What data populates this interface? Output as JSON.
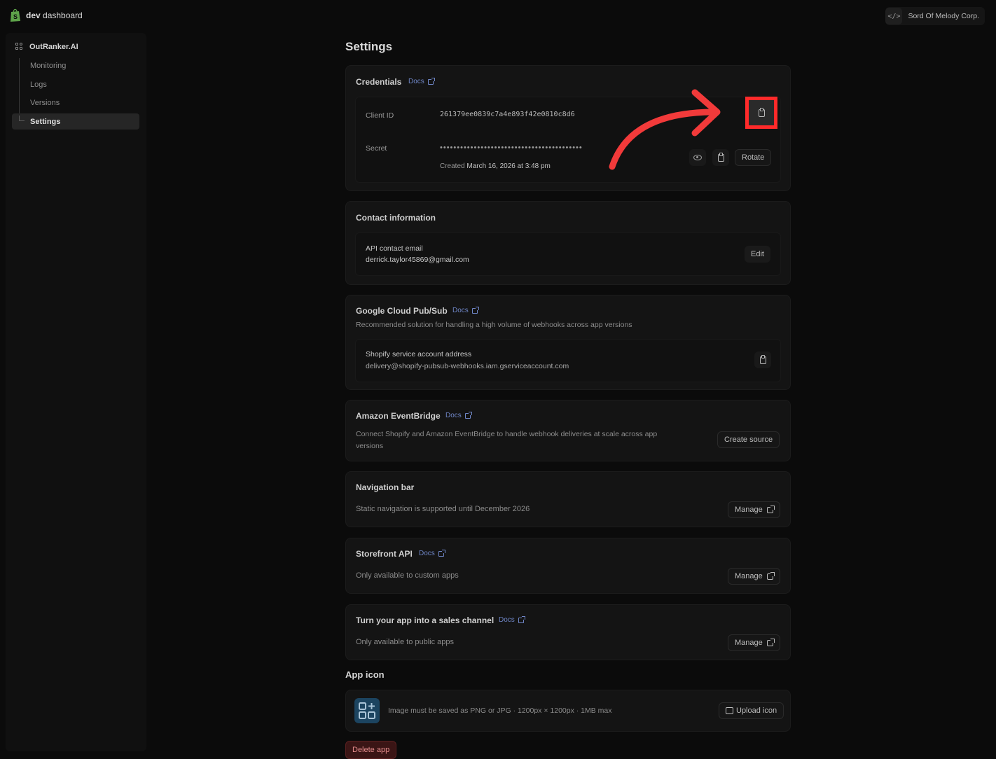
{
  "topbar": {
    "brand_bold": "dev",
    "brand_rest": " dashboard",
    "org_name": "Sord Of Melody Corp."
  },
  "sidebar": {
    "app_name": "OutRanker.AI",
    "items": [
      {
        "label": "Monitoring"
      },
      {
        "label": "Logs"
      },
      {
        "label": "Versions"
      },
      {
        "label": "Settings"
      }
    ]
  },
  "page": {
    "title": "Settings"
  },
  "credentials": {
    "title": "Credentials",
    "docs": "Docs",
    "client_id_label": "Client ID",
    "client_id_value": "261379ee0839c7a4e893f42e0810c8d6",
    "secret_label": "Secret",
    "secret_masked": "••••••••••••••••••••••••••••••••••••••••••",
    "created_prefix": "Created",
    "created_date": "March 16, 2026 at 3:48 pm",
    "rotate_label": "Rotate"
  },
  "contact": {
    "title": "Contact information",
    "email_label": "API contact email",
    "email_value": "derrick.taylor45869@gmail.com",
    "edit_label": "Edit"
  },
  "pubsub": {
    "title": "Google Cloud Pub/Sub",
    "docs": "Docs",
    "description": "Recommended solution for handling a high volume of webhooks across app versions",
    "account_label": "Shopify service account address",
    "account_value": "delivery@shopify-pubsub-webhooks.iam.gserviceaccount.com"
  },
  "eventbridge": {
    "title": "Amazon EventBridge",
    "docs": "Docs",
    "description_line1": "Connect Shopify and Amazon EventBridge to handle webhook deliveries at scale across app",
    "description_line2": "versions",
    "button_label": "Create source"
  },
  "navbar": {
    "title": "Navigation bar",
    "description": "Static navigation is supported until December 2026",
    "button_label": "Manage"
  },
  "storefront": {
    "title": "Storefront API",
    "docs": "Docs",
    "description": "Only available to custom apps",
    "button_label": "Manage"
  },
  "sales_channel": {
    "title": "Turn your app into a sales channel",
    "docs": "Docs",
    "description": "Only available to public apps",
    "button_label": "Manage"
  },
  "app_icon": {
    "title": "App icon",
    "hint": "Image must be saved as PNG or JPG · 1200px × 1200px · 1MB max",
    "button_label": "Upload icon"
  },
  "danger": {
    "delete_label": "Delete app"
  },
  "colors": {
    "highlight": "#ff2a2a",
    "arrow": "#f23a3a",
    "docs_link": "#6f86c7"
  }
}
